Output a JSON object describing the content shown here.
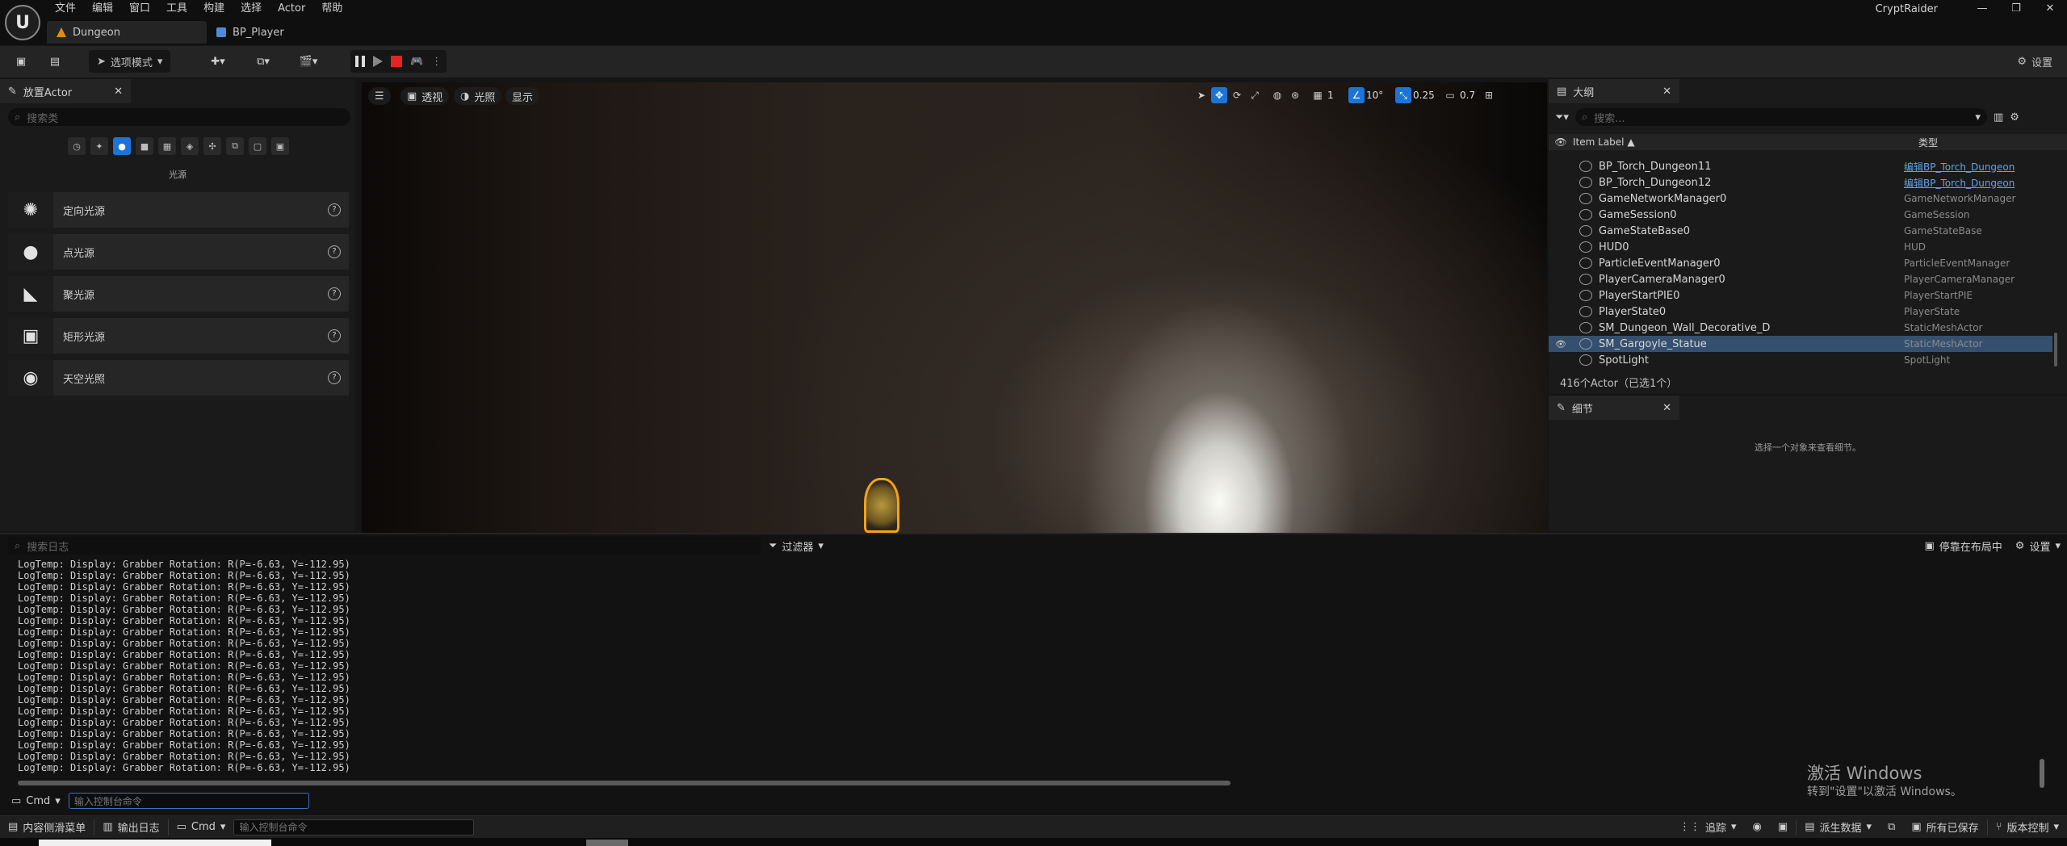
{
  "menu": [
    "文件",
    "编辑",
    "窗口",
    "工具",
    "构建",
    "选择",
    "Actor",
    "帮助"
  ],
  "doc_tabs": [
    {
      "label": "Dungeon"
    },
    {
      "label": "BP_Player"
    }
  ],
  "project_name": "CryptRaider",
  "toolbar": {
    "mode_label": "选项模式",
    "settings_label": "设置"
  },
  "place_actors": {
    "tab_label": "放置Actor",
    "search_placeholder": "搜索类",
    "category_label": "光源",
    "items": [
      {
        "label": "定向光源",
        "icon": "sun-icon"
      },
      {
        "label": "点光源",
        "icon": "bulb-icon"
      },
      {
        "label": "聚光源",
        "icon": "spotlight-icon"
      },
      {
        "label": "矩形光源",
        "icon": "rect-light-icon"
      },
      {
        "label": "天空光照",
        "icon": "sky-light-icon"
      }
    ]
  },
  "viewport": {
    "perspective_label": "透视",
    "lighting_label": "光照",
    "show_label": "显示",
    "grid_value": "1",
    "angle_value": "10°",
    "scale_value": "0.25",
    "camera_speed": "0.7"
  },
  "outliner": {
    "tab_label": "大纲",
    "search_placeholder": "搜索...",
    "col_label": "Item Label ▲",
    "col_type": "类型",
    "rows": [
      {
        "name": "BP_Torch_Dungeon11",
        "type": "编辑BP_Torch_Dungeon",
        "link": true,
        "selected": false
      },
      {
        "name": "BP_Torch_Dungeon12",
        "type": "编辑BP_Torch_Dungeon",
        "link": true,
        "selected": false
      },
      {
        "name": "GameNetworkManager0",
        "type": "GameNetworkManager",
        "link": false,
        "selected": false
      },
      {
        "name": "GameSession0",
        "type": "GameSession",
        "link": false,
        "selected": false
      },
      {
        "name": "GameStateBase0",
        "type": "GameStateBase",
        "link": false,
        "selected": false
      },
      {
        "name": "HUD0",
        "type": "HUD",
        "link": false,
        "selected": false
      },
      {
        "name": "ParticleEventManager0",
        "type": "ParticleEventManager",
        "link": false,
        "selected": false
      },
      {
        "name": "PlayerCameraManager0",
        "type": "PlayerCameraManager",
        "link": false,
        "selected": false
      },
      {
        "name": "PlayerStartPIE0",
        "type": "PlayerStartPIE",
        "link": false,
        "selected": false
      },
      {
        "name": "PlayerState0",
        "type": "PlayerState",
        "link": false,
        "selected": false
      },
      {
        "name": "SM_Dungeon_Wall_Decorative_D",
        "type": "StaticMeshActor",
        "link": false,
        "selected": false
      },
      {
        "name": "SM_Gargoyle_Statue",
        "type": "StaticMeshActor",
        "link": false,
        "selected": true
      },
      {
        "name": "SpotLight",
        "type": "SpotLight",
        "link": false,
        "selected": false
      }
    ],
    "count_label": "416个Actor（已选1个）"
  },
  "details": {
    "tab_label": "细节",
    "empty_text": "选择一个对象来查看细节。"
  },
  "output_log": {
    "search_placeholder": "搜索日志",
    "filter_label": "过滤器",
    "dock_label": "停靠在布局中",
    "settings_label": "设置",
    "line_text": "LogTemp: Display: Grabber Rotation: R(P=-6.63, Y=-112.95)",
    "line_count": 19,
    "cmd_label": "Cmd",
    "cmd_placeholder": "输入控制台命令"
  },
  "watermark": {
    "line1": "激活 Windows",
    "line2": "转到\"设置\"以激活 Windows。"
  },
  "statusbar": {
    "content_drawer": "内容侧滑菜单",
    "output_log": "输出日志",
    "cmd_label": "Cmd",
    "cmd_placeholder": "输入控制台命令",
    "trace": "追踪",
    "derived_data": "派生数据",
    "save_all": "所有已保存",
    "version_control": "版本控制"
  }
}
